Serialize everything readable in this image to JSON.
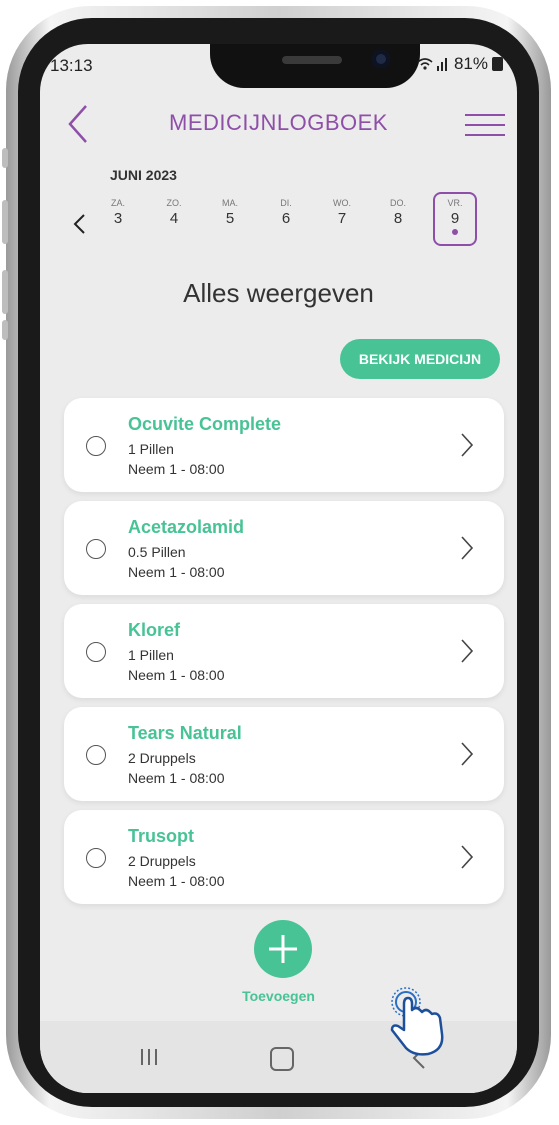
{
  "status_bar": {
    "time": "13:13",
    "battery": "81%"
  },
  "header": {
    "title": "MEDICIJNLOGBOEK"
  },
  "calendar": {
    "month": "JUNI 2023",
    "days": [
      {
        "name": "ZA.",
        "date": "3"
      },
      {
        "name": "ZO.",
        "date": "4"
      },
      {
        "name": "MA.",
        "date": "5"
      },
      {
        "name": "DI.",
        "date": "6"
      },
      {
        "name": "WO.",
        "date": "7"
      },
      {
        "name": "DO.",
        "date": "8"
      },
      {
        "name": "VR.",
        "date": "9",
        "selected": true
      }
    ]
  },
  "main": {
    "heading": "Alles weergeven",
    "view_button": "BEKIJK MEDICIJN",
    "medications": [
      {
        "name": "Ocuvite Complete",
        "dose": "1 Pillen",
        "schedule": "Neem 1 - 08:00"
      },
      {
        "name": "Acetazolamid",
        "dose": "0.5 Pillen",
        "schedule": "Neem 1 - 08:00"
      },
      {
        "name": "Kloref",
        "dose": "1 Pillen",
        "schedule": "Neem 1 - 08:00"
      },
      {
        "name": "Tears Natural",
        "dose": "2 Druppels",
        "schedule": "Neem 1 - 08:00"
      },
      {
        "name": "Trusopt",
        "dose": "2 Druppels",
        "schedule": "Neem 1 - 08:00"
      }
    ],
    "add_label": "Toevoegen"
  },
  "colors": {
    "accent_purple": "#8e4fa8",
    "accent_green": "#48c396",
    "background": "#ececec"
  },
  "icons": [
    "back-arrow-icon",
    "hamburger-menu-icon",
    "chevron-left-icon",
    "radio-icon",
    "chevron-right-icon",
    "plus-icon",
    "recent-apps-icon",
    "home-icon",
    "nav-back-icon",
    "tap-hand-icon"
  ]
}
